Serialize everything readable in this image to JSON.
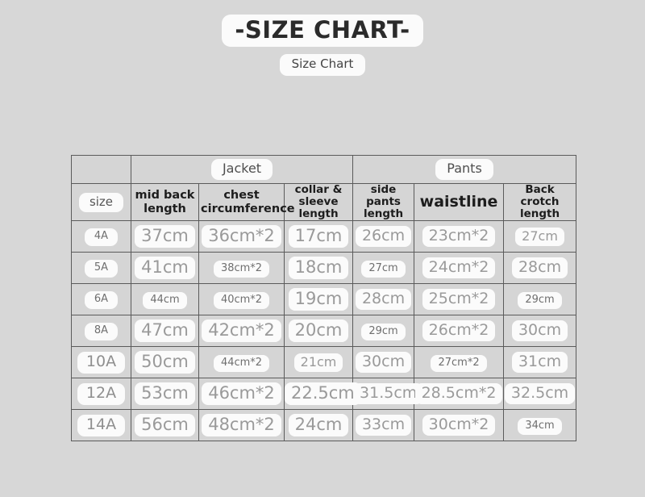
{
  "header": {
    "title": "-SIZE CHART-",
    "subtitle": "Size Chart"
  },
  "table": {
    "groups": [
      {
        "label": "",
        "span": 1
      },
      {
        "label": "Jacket",
        "span": 3
      },
      {
        "label": "Pants",
        "span": 3
      }
    ],
    "columns": [
      "size",
      "mid back length",
      "chest circumference",
      "collar & sleeve length",
      "side pants length",
      "waistline",
      "Back crotch length"
    ],
    "column_lines": [
      [
        "size"
      ],
      [
        "mid back",
        "length"
      ],
      [
        "chest",
        "circumference"
      ],
      [
        "collar & sleeve",
        "length"
      ],
      [
        "side pants",
        "length"
      ],
      [
        "waistline"
      ],
      [
        "Back crotch",
        "length"
      ]
    ],
    "rows": [
      {
        "size": "4A",
        "mid_back_length": "37cm",
        "chest_circumference": "36cm*2",
        "collar_sleeve_length": "17cm",
        "side_pants_length": "26cm",
        "waistline": "23cm*2",
        "back_crotch_length": "27cm"
      },
      {
        "size": "5A",
        "mid_back_length": "41cm",
        "chest_circumference": "38cm*2",
        "collar_sleeve_length": "18cm",
        "side_pants_length": "27cm",
        "waistline": "24cm*2",
        "back_crotch_length": "28cm"
      },
      {
        "size": "6A",
        "mid_back_length": "44cm",
        "chest_circumference": "40cm*2",
        "collar_sleeve_length": "19cm",
        "side_pants_length": "28cm",
        "waistline": "25cm*2",
        "back_crotch_length": "29cm"
      },
      {
        "size": "8A",
        "mid_back_length": "47cm",
        "chest_circumference": "42cm*2",
        "collar_sleeve_length": "20cm",
        "side_pants_length": "29cm",
        "waistline": "26cm*2",
        "back_crotch_length": "30cm"
      },
      {
        "size": "10A",
        "mid_back_length": "50cm",
        "chest_circumference": "44cm*2",
        "collar_sleeve_length": "21cm",
        "side_pants_length": "30cm",
        "waistline": "27cm*2",
        "back_crotch_length": "31cm"
      },
      {
        "size": "12A",
        "mid_back_length": "53cm",
        "chest_circumference": "46cm*2",
        "collar_sleeve_length": "22.5cm",
        "side_pants_length": "31.5cm",
        "waistline": "28.5cm*2",
        "back_crotch_length": "32.5cm"
      },
      {
        "size": "14A",
        "mid_back_length": "56cm",
        "chest_circumference": "48cm*2",
        "collar_sleeve_length": "24cm",
        "side_pants_length": "33cm",
        "waistline": "30cm*2",
        "back_crotch_length": "34cm"
      }
    ]
  },
  "colors": {
    "page_background": "#d7d7d7",
    "cell_background": "#d5d5d5",
    "border": "#5b5b5b",
    "pill_background": "#fbfbfb",
    "value_text": "#9a9a9a",
    "header_text": "#1d1d1d"
  }
}
